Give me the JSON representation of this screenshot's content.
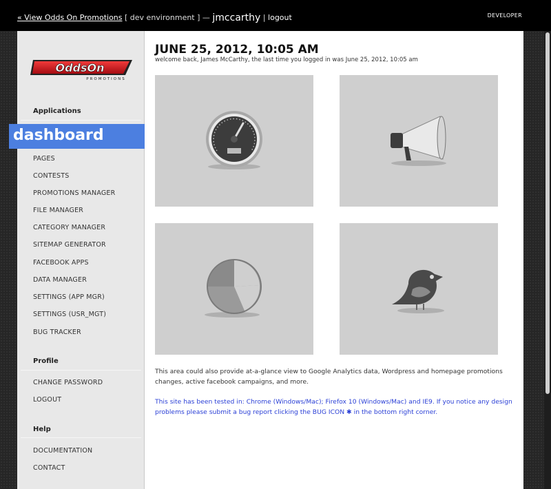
{
  "topbar": {
    "view_link": "« View Odds On Promotions",
    "environment": "[ dev environment ] —",
    "username": "jmccarthy",
    "separator": "|",
    "logout": "logout",
    "role": "DEVELOPER"
  },
  "sidebar": {
    "logo_icon": "oddson-promotions-logo",
    "logo_text": "OddsOn",
    "logo_subtext": "PROMOTIONS",
    "applications_heading": "Applications",
    "dashboard_label": "dashboard",
    "app_items": [
      "PAGES",
      "CONTESTS",
      "PROMOTIONS MANAGER",
      "FILE MANAGER",
      "CATEGORY MANAGER",
      "SITEMAP GENERATOR",
      "FACEBOOK APPS",
      "DATA MANAGER",
      "SETTINGS (APP MGR)",
      "SETTINGS (USR_MGT)",
      "BUG TRACKER"
    ],
    "profile_heading": "Profile",
    "profile_items": [
      "CHANGE PASSWORD",
      "LOGOUT"
    ],
    "help_heading": "Help",
    "help_items": [
      "DOCUMENTATION",
      "CONTACT"
    ]
  },
  "main": {
    "title": "JUNE 25, 2012, 10:05 AM",
    "welcome": "welcome back, James McCarthy, the last time you logged in was June 25, 2012, 10:05 am",
    "tiles": [
      {
        "icon": "speedometer-icon"
      },
      {
        "icon": "megaphone-icon"
      },
      {
        "icon": "pie-chart-icon"
      },
      {
        "icon": "bird-icon"
      }
    ],
    "body_text": "This area could also provide at-a-glance view to Google Analytics data, Wordpress and homepage promotions changes, active facebook campaigns, and more.",
    "note_text": "This site has been tested in: Chrome (Windows/Mac); Firefox 10 (Windows/Mac) and IE9. If you notice any design problems please submit a bug report clicking the BUG ICON ✱ in the bottom right corner."
  },
  "colors": {
    "accent": "#4c7fe0",
    "link_blue": "#2a3fd6",
    "tile_bg": "#cfcfcf",
    "logo_red": "#d3141d"
  }
}
